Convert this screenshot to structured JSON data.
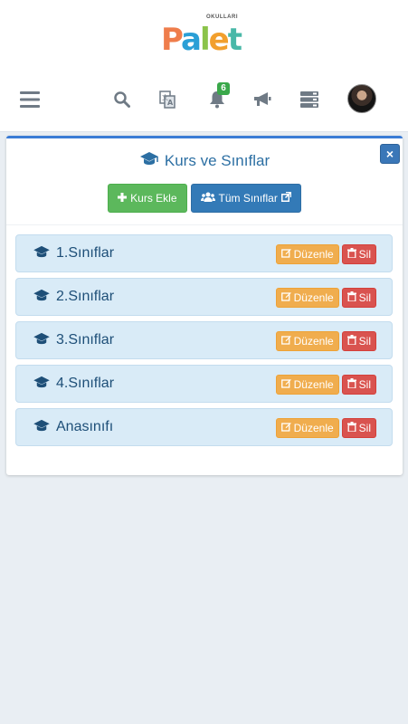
{
  "header": {
    "logo": {
      "word": "Palet",
      "tagline": "OKULLARI"
    },
    "nav": {
      "menu_icon": "hamburger-icon",
      "search_icon": "search-icon",
      "translate_icon": "translate-icon",
      "notifications_icon": "bell-icon",
      "notifications_count": "6",
      "announcements_icon": "megaphone-icon",
      "server_icon": "server-icon"
    }
  },
  "panel": {
    "title": "Kurs ve Sınıflar",
    "close_label": "×",
    "add_button": "Kurs Ekle",
    "all_classes_button": "Tüm Sınıflar",
    "rows": [
      {
        "label": "1.Sınıflar",
        "edit": "Düzenle",
        "delete": "Sil"
      },
      {
        "label": "2.Sınıflar",
        "edit": "Düzenle",
        "delete": "Sil"
      },
      {
        "label": "3.Sınıflar",
        "edit": "Düzenle",
        "delete": "Sil"
      },
      {
        "label": "4.Sınıflar",
        "edit": "Düzenle",
        "delete": "Sil"
      },
      {
        "label": "Anasınıfı",
        "edit": "Düzenle",
        "delete": "Sil"
      }
    ]
  },
  "colors": {
    "primary": "#337ab7",
    "success": "#5cb85c",
    "warning": "#f0ad4e",
    "danger": "#d9534f",
    "row_bg": "#d9ebf7",
    "badge": "#3aa84a"
  }
}
